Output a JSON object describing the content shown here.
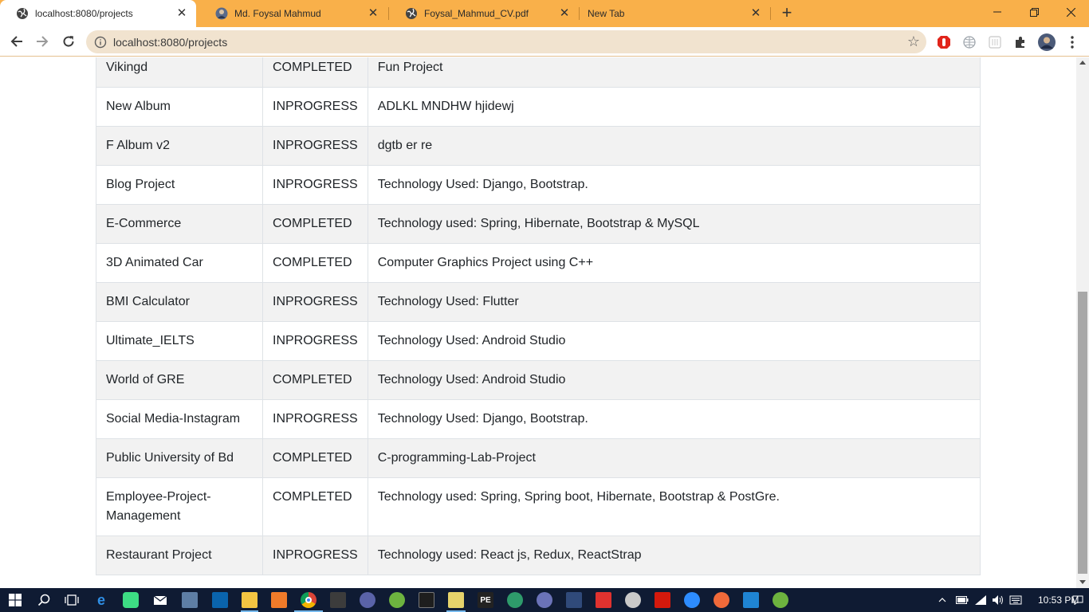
{
  "browser": {
    "tabs": [
      {
        "title": "localhost:8080/projects",
        "active": true,
        "icon": "globe-icon"
      },
      {
        "title": "Md. Foysal Mahmud",
        "active": false,
        "icon": "profile-avatar-icon"
      },
      {
        "title": "Foysal_Mahmud_CV.pdf",
        "active": false,
        "icon": "globe-icon"
      },
      {
        "title": "New Tab",
        "active": false,
        "icon": ""
      }
    ],
    "address": "localhost:8080/projects",
    "accent_color": "#f9b04a"
  },
  "projects": [
    {
      "name": "Vikingd",
      "status": "COMPLETED",
      "description": "Fun Project"
    },
    {
      "name": "New Album",
      "status": "INPROGRESS",
      "description": "ADLKL MNDHW hjidewj"
    },
    {
      "name": "F Album v2",
      "status": "INPROGRESS",
      "description": "dgtb er re"
    },
    {
      "name": "Blog Project",
      "status": "INPROGRESS",
      "description": "Technology Used: Django, Bootstrap."
    },
    {
      "name": "E-Commerce",
      "status": "COMPLETED",
      "description": "Technology used: Spring, Hibernate, Bootstrap & MySQL"
    },
    {
      "name": "3D Animated Car",
      "status": "COMPLETED",
      "description": "Computer Graphics Project using C++"
    },
    {
      "name": "BMI Calculator",
      "status": "INPROGRESS",
      "description": "Technology Used: Flutter"
    },
    {
      "name": "Ultimate_IELTS",
      "status": "INPROGRESS",
      "description": "Technology Used: Android Studio"
    },
    {
      "name": "World of GRE",
      "status": "COMPLETED",
      "description": "Technology Used: Android Studio"
    },
    {
      "name": "Social Media-Instagram",
      "status": "INPROGRESS",
      "description": "Technology Used: Django, Bootstrap."
    },
    {
      "name": "Public University of Bd",
      "status": "COMPLETED",
      "description": "C-programming-Lab-Project"
    },
    {
      "name": "Employee-Project-Management",
      "status": "COMPLETED",
      "description": "Technology used: Spring, Spring boot, Hibernate, Bootstrap & PostGre."
    },
    {
      "name": "Restaurant Project",
      "status": "INPROGRESS",
      "description": "Technology used: React js, Redux, ReactStrap"
    }
  ],
  "taskbar": {
    "clock": "10:53 PM"
  }
}
